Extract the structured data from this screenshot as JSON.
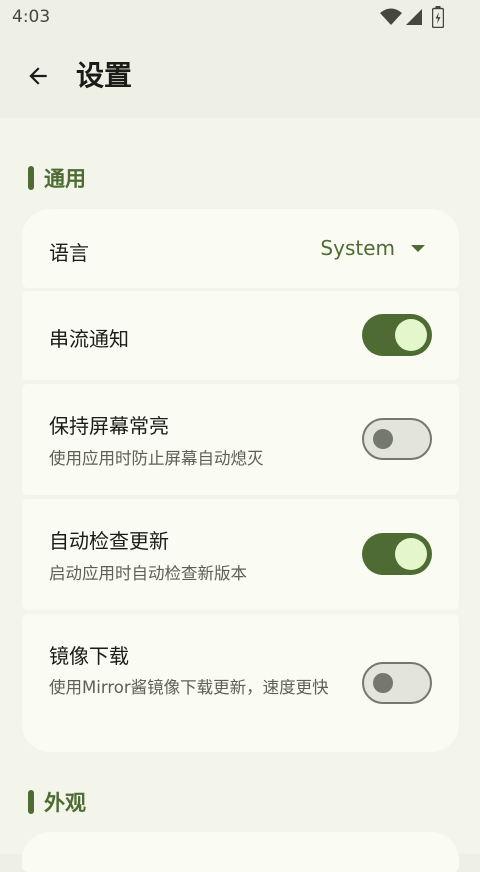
{
  "status_bar": {
    "time": "4:03",
    "icons": [
      "wifi-icon",
      "cellular-signal-icon",
      "battery-icon"
    ]
  },
  "app_bar": {
    "back_icon": "arrow-back-icon",
    "title": "设置"
  },
  "sections": {
    "general": {
      "title": "通用",
      "language": {
        "label": "语言",
        "value": "System"
      },
      "stream_notification": {
        "label": "串流通知",
        "enabled": true
      },
      "keep_screen_on": {
        "label": "保持屏幕常亮",
        "description": "使用应用时防止屏幕自动熄灭",
        "enabled": false
      },
      "auto_check_update": {
        "label": "自动检查更新",
        "description": "启动应用时自动检查新版本",
        "enabled": true
      },
      "mirror_download": {
        "label": "镜像下载",
        "description": "使用Mirror酱镜像下载更新，速度更快",
        "enabled": false
      }
    },
    "appearance": {
      "title": "外观"
    }
  },
  "colors": {
    "accent": "#4d6b33",
    "background": "#eef0e5",
    "card": "#fafbf3",
    "switch_on_knob": "#e4f7cc",
    "switch_off_outline": "#75786c"
  }
}
